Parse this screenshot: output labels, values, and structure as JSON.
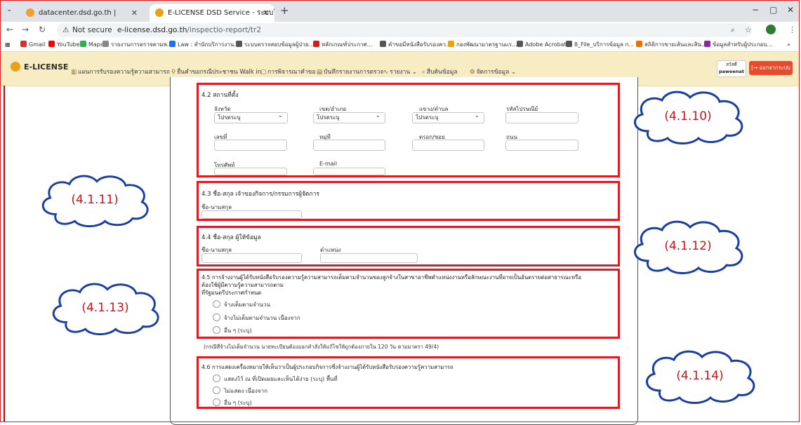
{
  "browser": {
    "tabs": [
      {
        "title": "datacenter.dsd.go.th |",
        "close": "✕"
      },
      {
        "title": "E-LICENSE DSD Service - ระบบใบ",
        "close": "✕"
      }
    ],
    "new_tab": "+",
    "window_controls": [
      "−",
      "▢",
      "✕"
    ],
    "not_secure": "Not secure",
    "url_host": "e-license.dsd.go.th",
    "url_path": "/inspectio-report/tr2",
    "bookmarks": [
      "Gmail",
      "YouTube",
      "Maps",
      "รายงานการตรวจตามพ...",
      "Law : สำนักบริการงาน...",
      "ระบบตรวจสอบข้อมูลผู้ป่วย...",
      "หลักเกณฑ์ประกาศ...",
      "คำขอมีหนังสือรับรองคว...",
      "กองพัฒนามาตรฐานแร...",
      "Adobe Acrobat",
      "8_File_บริการข้อมูล ก...",
      "สถิติการขายเส้นและสิน...",
      "ข้อมูลสำหรับผู้ประกอบ..."
    ],
    "more_bookmarks": "»"
  },
  "app": {
    "logo": "E-LICENSE",
    "nav": [
      {
        "icon": "▥",
        "label": "แผนการรับรองความรู้ความสามารถ"
      },
      {
        "icon": "⚲",
        "label": "ยื่นคำขอกรณีประชาชน Walk in"
      },
      {
        "icon": "▢",
        "label": "การพิจารณาคำขอ"
      },
      {
        "icon": "▤",
        "label": "บันทึกรายงานการตรวจ"
      },
      {
        "icon": "∿",
        "label": "รายงาน ⌄"
      },
      {
        "icon": "⌕",
        "label": "สืบค้นข้อมูล"
      },
      {
        "icon": "⚙",
        "label": "จัดการข้อมูล ⌄"
      }
    ],
    "user_line1": "สวัสดี",
    "user_line2": "paweenat",
    "logout": "[→ ออกจากระบบ"
  },
  "form": {
    "s42": {
      "title": "4.2 สถานที่ตั้ง",
      "province_label": "จังหวัด",
      "province_value": "โปรดระบุ",
      "district_label": "เขต/อำเภอ",
      "district_value": "โปรดระบุ",
      "subdistrict_label": "แขวง/ตำบล",
      "subdistrict_value": "โปรดระบุ",
      "postcode_label": "รหัสไปรษณีย์",
      "number_label": "เลขที่",
      "moo_label": "หมู่ที่",
      "soi_label": "ตรอก/ซอย",
      "road_label": "ถนน",
      "phone_label": "โทรศัพท์",
      "email_label": "E-mail"
    },
    "s43": {
      "title": "4.3 ชื่อ-สกุล เจ้าของกิจการ/กรรมการผู้จัดการ",
      "name_label": "ชื่อ-นามสกุล"
    },
    "s44": {
      "title": "4.4 ชื่อ-สกุล ผู้ให้ข้อมูล",
      "name_label": "ชื่อ-นามสกุล",
      "position_label": "ตำแหน่ง"
    },
    "s45": {
      "title_line1": "4.5 การจ้างงานผู้ได้รับหนังสือรับรองความรู้ความสามารถเต็มตามจำนวนของลูกจ้างในสาขาอาชีพตำแหน่งงานหรือลักษณะงานที่อาจเป็นอันตรายต่อสาธารณะหรือ",
      "title_line2": "ต้องใช้ผู้มีความรู้ความสามารถตาม",
      "title_line3": "ที่รัฐมนตรีประกาศกำหนด",
      "options": [
        "จ้างเต็มตามจำนวน",
        "จ้างไม่เต็มตามจำนวน เนื่องจาก",
        "อื่น ๆ (ระบุ)"
      ],
      "note": "(กรณีที่จ้างไม่เต็มจำนวน นายทะเบียนต้องออกคำสั่งให้แก้ไขให้ถูกต้องภายใน 120 วัน ตามมาตรา 49/4)"
    },
    "s46": {
      "title": "4.6 การแสดงเครื่องหมายให้เห็นว่าเป็นผู้ประกอบกิจการซึ่งจ้างงานผู้ได้รับหนังสือรับรองความรู้ความสามารถ",
      "options": [
        "แสดงไว้ ณ ที่เปิดเผยและเห็นได้ง่าย (ระบุ) พื้นที่",
        "ไม่แสดง เนื่องจาก",
        "อื่น ๆ (ระบุ)"
      ]
    }
  },
  "annotations": [
    "(4.1.10)",
    "(4.1.11)",
    "(4.1.12)",
    "(4.1.13)",
    "(4.1.14)"
  ]
}
